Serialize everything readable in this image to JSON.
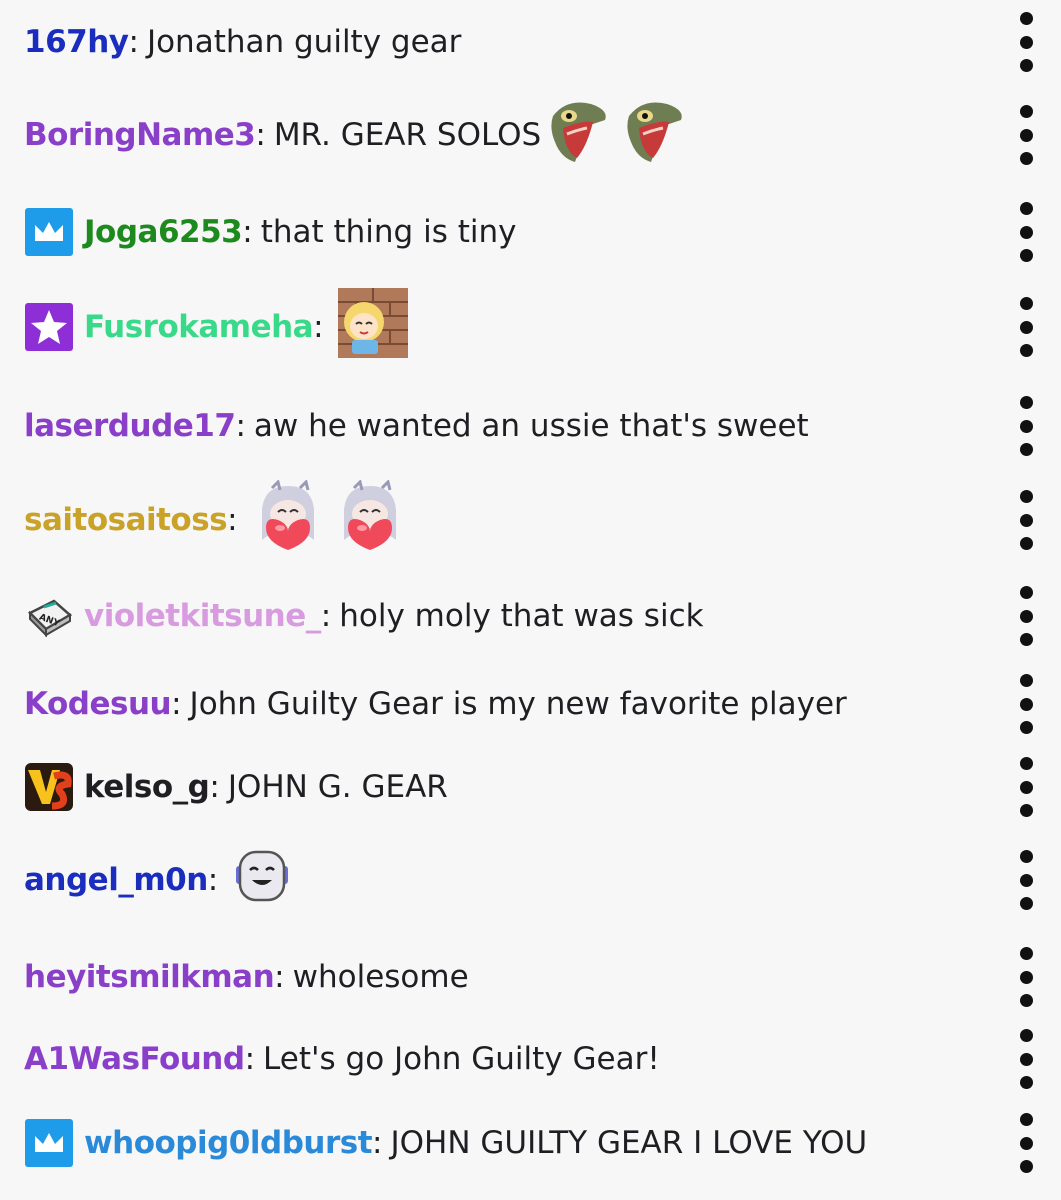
{
  "messages": [
    {
      "user": "167hy",
      "color": "#1a2dbd",
      "text": "Jonathan guilty gear",
      "badge": null,
      "emotes": []
    },
    {
      "user": "BoringName3",
      "color": "#8a3fc9",
      "text": "MR. GEAR SOLOS",
      "badge": null,
      "emotes": [
        "screaming-frog-emote",
        "screaming-frog-emote"
      ]
    },
    {
      "user": "Joga6253",
      "color": "#1d8a1d",
      "text": "that thing is tiny",
      "badge": "prime-crown-badge",
      "emotes": []
    },
    {
      "user": "Fusrokameha",
      "color": "#39d98a",
      "text": "",
      "badge": "star-badge",
      "emotes": [
        "blonde-girl-bricks-emote"
      ]
    },
    {
      "user": "laserdude17",
      "color": "#8a3fc9",
      "text": "aw he wanted an ussie that's sweet",
      "badge": null,
      "emotes": []
    },
    {
      "user": "saitosaitoss",
      "color": "#c9a227",
      "text": "",
      "badge": null,
      "emotes": [
        "anime-girl-heart-emote",
        "anime-girl-heart-emote"
      ]
    },
    {
      "user": "violetkitsune_",
      "color": "#d89be0",
      "text": "holy moly that was sick",
      "badge": "any-key-badge",
      "emotes": []
    },
    {
      "user": "Kodesuu",
      "color": "#8a3fc9",
      "text": "John Guilty Gear is my new favorite player",
      "badge": null,
      "emotes": []
    },
    {
      "user": "kelso_g",
      "color": "#1f1f23",
      "text": "JOHN G. GEAR",
      "badge": "vs-badge",
      "emotes": []
    },
    {
      "user": "angel_m0n",
      "color": "#1a2dbd",
      "text": "",
      "badge": null,
      "emotes": [
        "smiling-robot-emote"
      ]
    },
    {
      "user": "heyitsmilkman",
      "color": "#8a3fc9",
      "text": "wholesome",
      "badge": null,
      "emotes": []
    },
    {
      "user": "A1WasFound",
      "color": "#8a3fc9",
      "text": "Let's go John Guilty Gear!",
      "badge": null,
      "emotes": []
    },
    {
      "user": "whoopig0ldburst",
      "color": "#2a8ad8",
      "text": "JOHN GUILTY GEAR I LOVE YOU",
      "badge": "prime-crown-badge",
      "emotes": []
    }
  ],
  "colon": ":",
  "menu_icon": "more-vertical-icon"
}
